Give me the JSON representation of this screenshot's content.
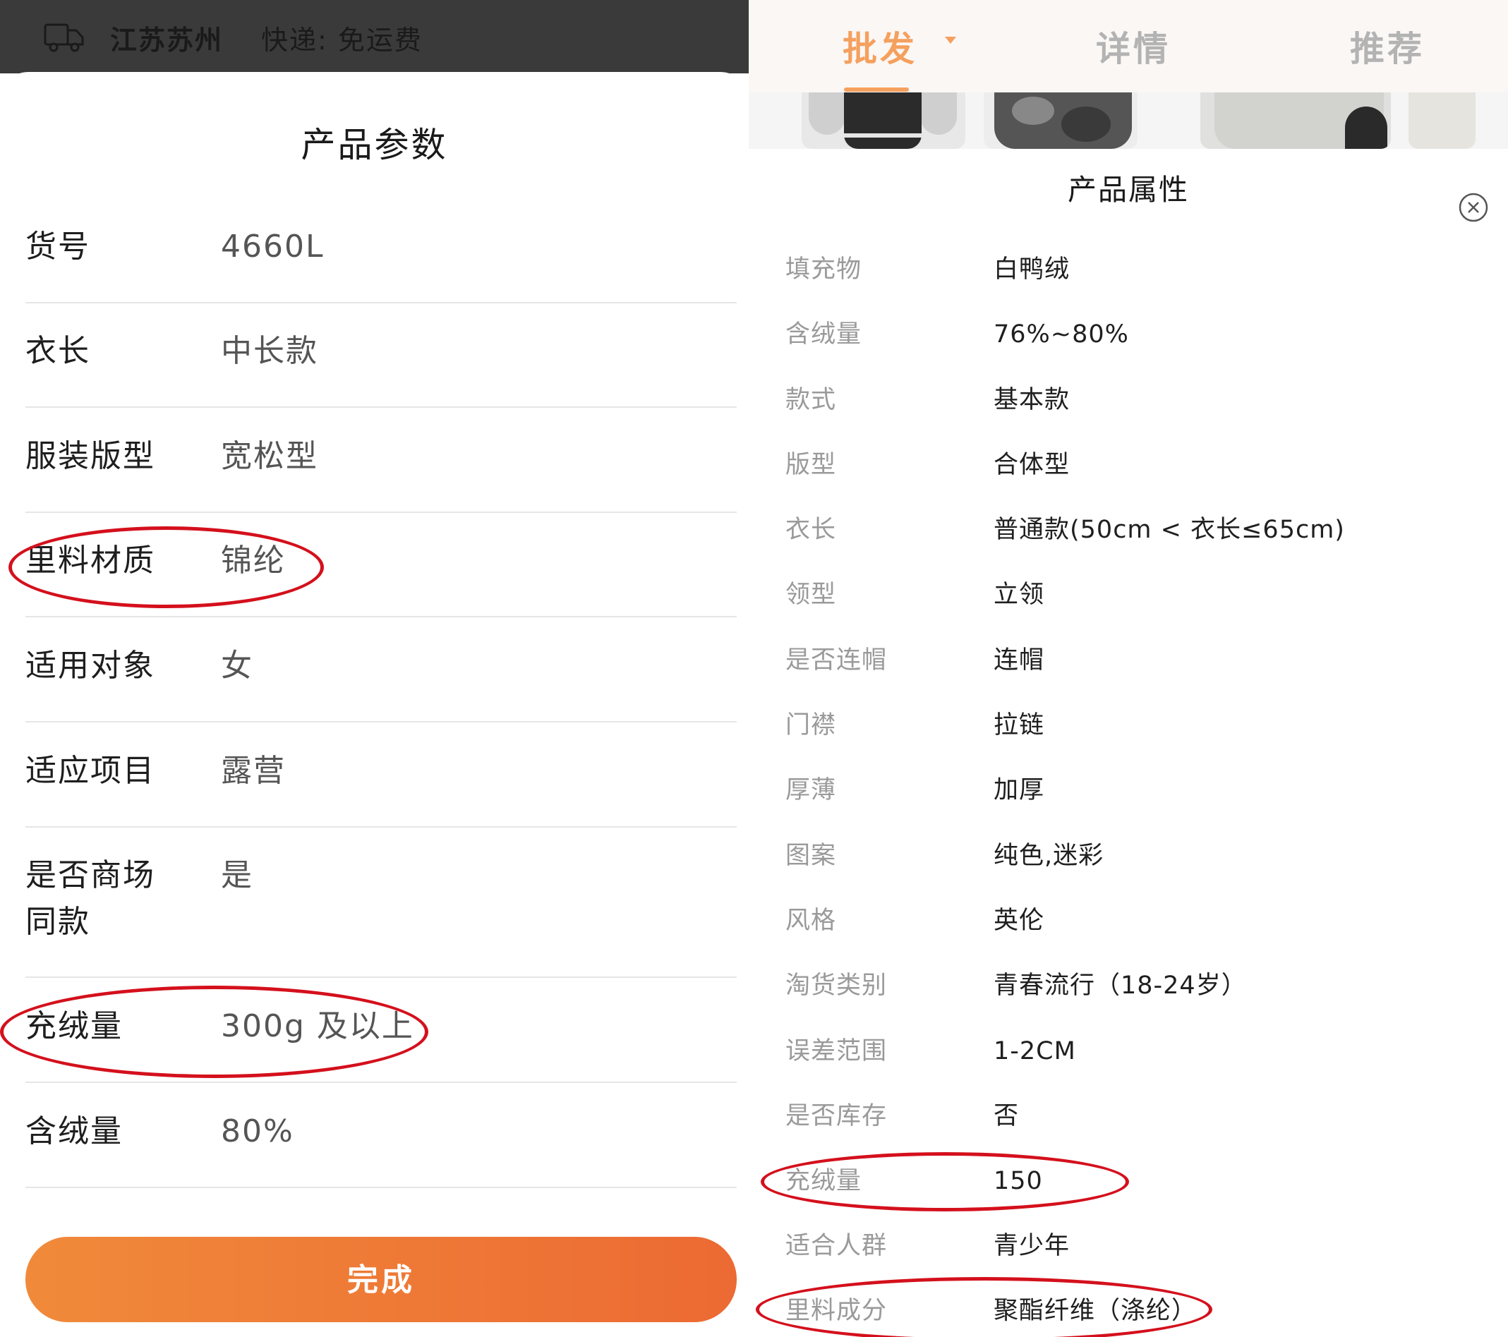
{
  "left": {
    "location": "江苏苏州",
    "shipping": "快递: 免运费",
    "title": "产品参数",
    "params": [
      {
        "key": "货号",
        "value": "4660L"
      },
      {
        "key": "衣长",
        "value": "中长款"
      },
      {
        "key": "服装版型",
        "value": "宽松型"
      },
      {
        "key": "里料材质",
        "value": "锦纶"
      },
      {
        "key": "适用对象",
        "value": "女"
      },
      {
        "key": "适应项目",
        "value": "露营"
      },
      {
        "key": "是否商场同款",
        "value": "是"
      },
      {
        "key": "充绒量",
        "value": "300g 及以上"
      },
      {
        "key": "含绒量",
        "value": "80%"
      }
    ],
    "done_label": "完成"
  },
  "right": {
    "tabs": [
      {
        "label": "批发",
        "active": true
      },
      {
        "label": "详情",
        "active": false
      },
      {
        "label": "推荐",
        "active": false
      }
    ],
    "title": "产品属性",
    "attributes": [
      {
        "key": "填充物",
        "value": "白鸭绒"
      },
      {
        "key": "含绒量",
        "value": "76%~80%"
      },
      {
        "key": "款式",
        "value": "基本款"
      },
      {
        "key": "版型",
        "value": "合体型"
      },
      {
        "key": "衣长",
        "value": "普通款(50cm < 衣长≤65cm)"
      },
      {
        "key": "领型",
        "value": "立领"
      },
      {
        "key": "是否连帽",
        "value": "连帽"
      },
      {
        "key": "门襟",
        "value": "拉链"
      },
      {
        "key": "厚薄",
        "value": "加厚"
      },
      {
        "key": "图案",
        "value": "纯色,迷彩"
      },
      {
        "key": "风格",
        "value": "英伦"
      },
      {
        "key": "淘货类别",
        "value": "青春流行（18-24岁）"
      },
      {
        "key": "误差范围",
        "value": "1-2CM"
      },
      {
        "key": "是否库存",
        "value": "否"
      },
      {
        "key": "充绒量",
        "value": "150"
      },
      {
        "key": "适合人群",
        "value": "青少年"
      },
      {
        "key": "里料成分",
        "value": "聚酯纤维（涤纶）"
      }
    ]
  },
  "colors": {
    "accent": "#ec6a33",
    "tab_active": "#f5a05e",
    "annotation": "#d4101c",
    "topbar": "#3a3a3a"
  },
  "icons": [
    "truck-icon",
    "close-icon",
    "dropdown-arrow-icon"
  ]
}
